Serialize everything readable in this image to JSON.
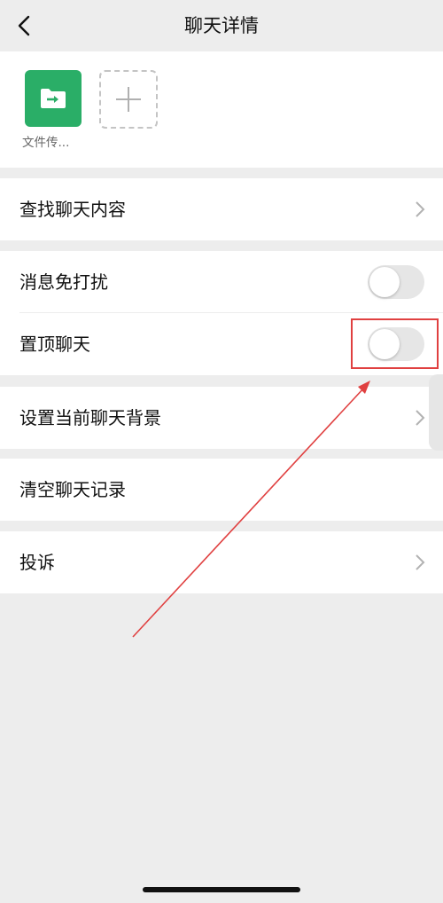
{
  "nav": {
    "title": "聊天详情"
  },
  "members": [
    {
      "name": "文件传...",
      "icon": "file-transfer-icon",
      "color": "#2aae67"
    }
  ],
  "rows": {
    "search_history": "查找聊天内容",
    "mute": {
      "label": "消息免打扰",
      "on": false
    },
    "pin": {
      "label": "置顶聊天",
      "on": false
    },
    "background": "设置当前聊天背景",
    "clear_history": "清空聊天记录",
    "report": "投诉"
  },
  "colors": {
    "page_background": "#ededed",
    "accent": "#2aae67",
    "annotation": "#e04040"
  }
}
